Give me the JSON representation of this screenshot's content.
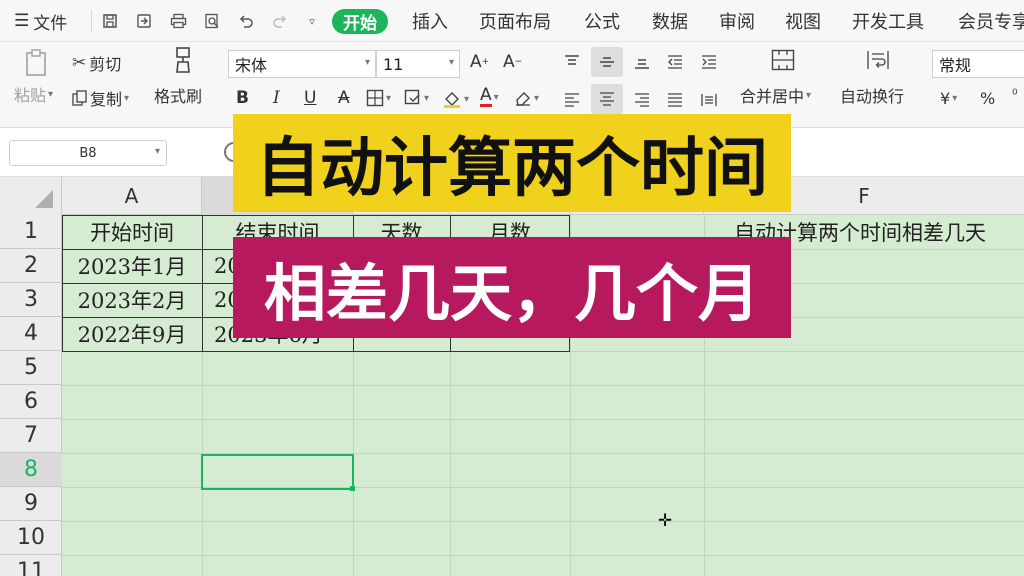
{
  "menubar": {
    "file_label": "文件",
    "tabs": [
      "开始",
      "插入",
      "页面布局",
      "公式",
      "数据",
      "审阅",
      "视图",
      "开发工具",
      "会员专享"
    ]
  },
  "ribbon": {
    "paste_label": "粘贴",
    "cut_label": "剪切",
    "copy_label": "复制",
    "format_painter_label": "格式刷",
    "font_name": "宋体",
    "font_size": "11",
    "merge_center_label": "合并居中",
    "wrap_text_label": "自动换行",
    "number_format": "常规",
    "currency_symbol": "¥",
    "percent_symbol": "%"
  },
  "formula_bar": {
    "name_box": "B8"
  },
  "sheet": {
    "columns": [
      "A",
      "F"
    ],
    "rows": [
      "1",
      "2",
      "3",
      "4",
      "5",
      "6",
      "7",
      "8",
      "9",
      "10",
      "11"
    ],
    "cells": {
      "a1": "开始时间",
      "b1": "结束时间",
      "c1": "天数",
      "d1": "月数",
      "f1": "自动计算两个时间相差几天",
      "a2": "2023年1月",
      "b2": "20",
      "a3": "2023年2月",
      "b3": "20",
      "a4": "2022年9月",
      "b4": "2023年6月"
    }
  },
  "overlay": {
    "title_line1": "自动计算两个时间",
    "title_line2": "相差几天，几个月"
  },
  "colors": {
    "accent": "#1db55c",
    "sheet_background": "#d6ecd2",
    "banner_yellow": "#f0d21c",
    "banner_magenta": "#b7195e"
  }
}
